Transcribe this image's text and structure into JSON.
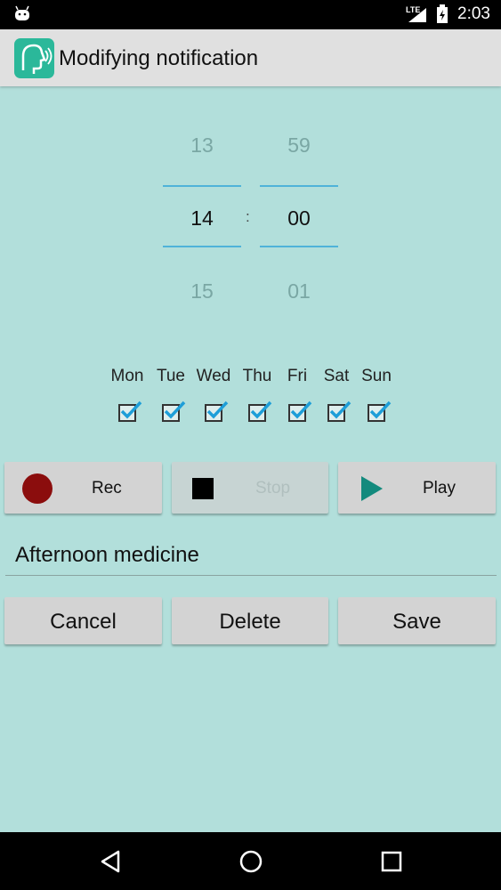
{
  "status_bar": {
    "network": "LTE",
    "time": "2:03"
  },
  "header": {
    "title": "Modifying notification",
    "icon": "face-speaking-icon"
  },
  "time_picker": {
    "hours": {
      "prev": "13",
      "current": "14",
      "next": "15"
    },
    "separator": ":",
    "minutes": {
      "prev": "59",
      "current": "00",
      "next": "01"
    }
  },
  "days": [
    {
      "label": "Mon",
      "checked": true
    },
    {
      "label": "Tue",
      "checked": true
    },
    {
      "label": "Wed",
      "checked": true
    },
    {
      "label": "Thu",
      "checked": true
    },
    {
      "label": "Fri",
      "checked": true
    },
    {
      "label": "Sat",
      "checked": true
    },
    {
      "label": "Sun",
      "checked": true
    }
  ],
  "recorder": {
    "rec_label": "Rec",
    "stop_label": "Stop",
    "play_label": "Play"
  },
  "message": {
    "value": "Afternoon medicine"
  },
  "actions": {
    "cancel_label": "Cancel",
    "delete_label": "Delete",
    "save_label": "Save"
  },
  "colors": {
    "background": "#b2dfdb",
    "accent": "#4fb3d9",
    "checkbox": "#1e9ed8",
    "record": "#8b0d0d",
    "play": "#138a7d"
  }
}
